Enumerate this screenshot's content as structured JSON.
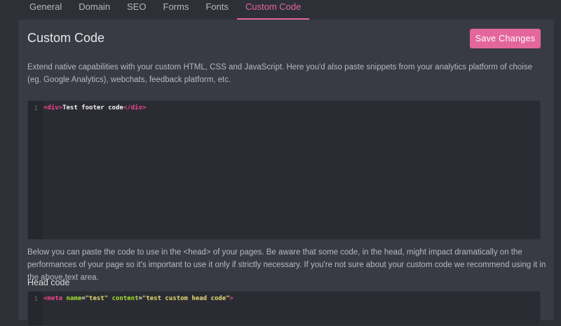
{
  "tabs": [
    {
      "label": "General"
    },
    {
      "label": "Domain"
    },
    {
      "label": "SEO"
    },
    {
      "label": "Forms"
    },
    {
      "label": "Fonts"
    },
    {
      "label": "Custom Code"
    }
  ],
  "active_tab": "Custom Code",
  "page": {
    "title": "Custom Code",
    "save_label": "Save Changes",
    "description": "Extend native capabilities with your custom HTML, CSS and JavaScript. Here you'd also paste snippets from your analytics platform of choise (eg. Google Analytics), webchats, feedback platform, etc.",
    "head_description": "Below you can paste the code to use in the <head> of your pages. Be aware that some code, in the head, might impact dramatically on the performances of your page so it's important to use it only if strictly necessary. If you're not sure about your custom code we recommend using it in the above text area.",
    "head_label": "Head code"
  },
  "footer_editor": {
    "line_number": "1",
    "tokens": {
      "open_tag": "<div>",
      "text": "Test footer code",
      "close_tag": "</div>"
    }
  },
  "head_editor": {
    "line_number": "1",
    "tokens": {
      "tag_open": "<meta",
      "attr1": "name",
      "eq1": "=",
      "val1": "\"test\"",
      "attr2": "content",
      "eq2": "=",
      "val2": "\"test custom head code\"",
      "tag_close": ">"
    }
  },
  "colors": {
    "accent": "#e3669c",
    "background": "#2e3038",
    "panel": "#393b44",
    "editor": "#2b2c33"
  }
}
